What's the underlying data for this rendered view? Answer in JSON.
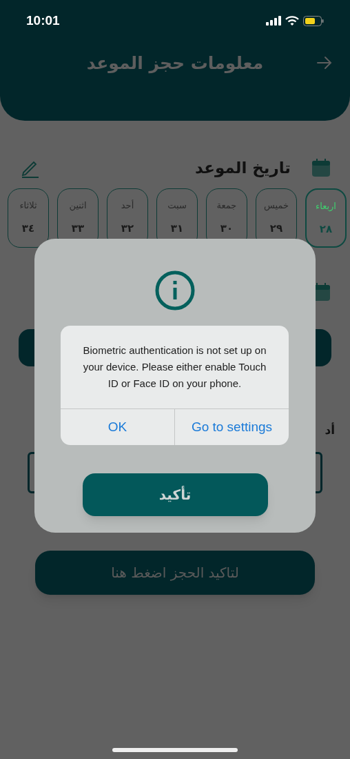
{
  "status_bar": {
    "time": "10:01"
  },
  "header": {
    "title": "معلومات حجز الموعد"
  },
  "date_section": {
    "title": "تاريخ الموعد"
  },
  "days": [
    {
      "name": "اربعاء",
      "number": "٢٨",
      "selected": true
    },
    {
      "name": "خميس",
      "number": "٢٩",
      "selected": false
    },
    {
      "name": "جمعة",
      "number": "٣٠",
      "selected": false
    },
    {
      "name": "سبت",
      "number": "٣١",
      "selected": false
    },
    {
      "name": "أحد",
      "number": "٣٢",
      "selected": false
    },
    {
      "name": "اثنين",
      "number": "٣٣",
      "selected": false
    },
    {
      "name": "ثلاثاء",
      "number": "٣٤",
      "selected": false
    }
  ],
  "field_label": "أد",
  "modal": {
    "confirm_button": "تأكيد"
  },
  "alert": {
    "message": "Biometric authentication is not set up on your device. Please either enable Touch ID or Face ID on your phone.",
    "ok_button": "OK",
    "settings_button": "Go to settings"
  },
  "bottom_button": "لتاكيد الحجز اضغط هنا"
}
